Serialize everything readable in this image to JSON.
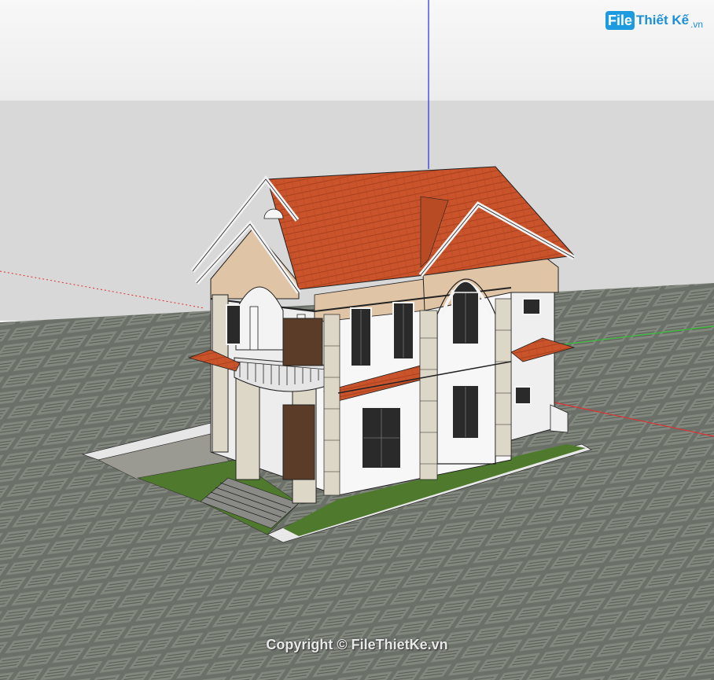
{
  "watermark": {
    "logo_badge": "File",
    "logo_name": "Thiết Kế",
    "logo_tld": ".vn",
    "copyright": "Copyright © FileThietKe.vn"
  },
  "colors": {
    "sky": "#f4f4f4",
    "horizon": "#d9d9d9",
    "ground": "#6d726b",
    "roof": "#c9532a",
    "wall": "#f7f7f7",
    "accent_wall": "#e0c4a6",
    "column": "#dcd7c7",
    "grass": "#4f7a2e",
    "axis_blue": "#2a2ae0",
    "axis_red": "#e03030",
    "axis_green": "#30c030",
    "logo_blue": "#1c9be0"
  },
  "icons": {
    "model": "house-3d-model",
    "axes": "axis-guides-icon"
  }
}
